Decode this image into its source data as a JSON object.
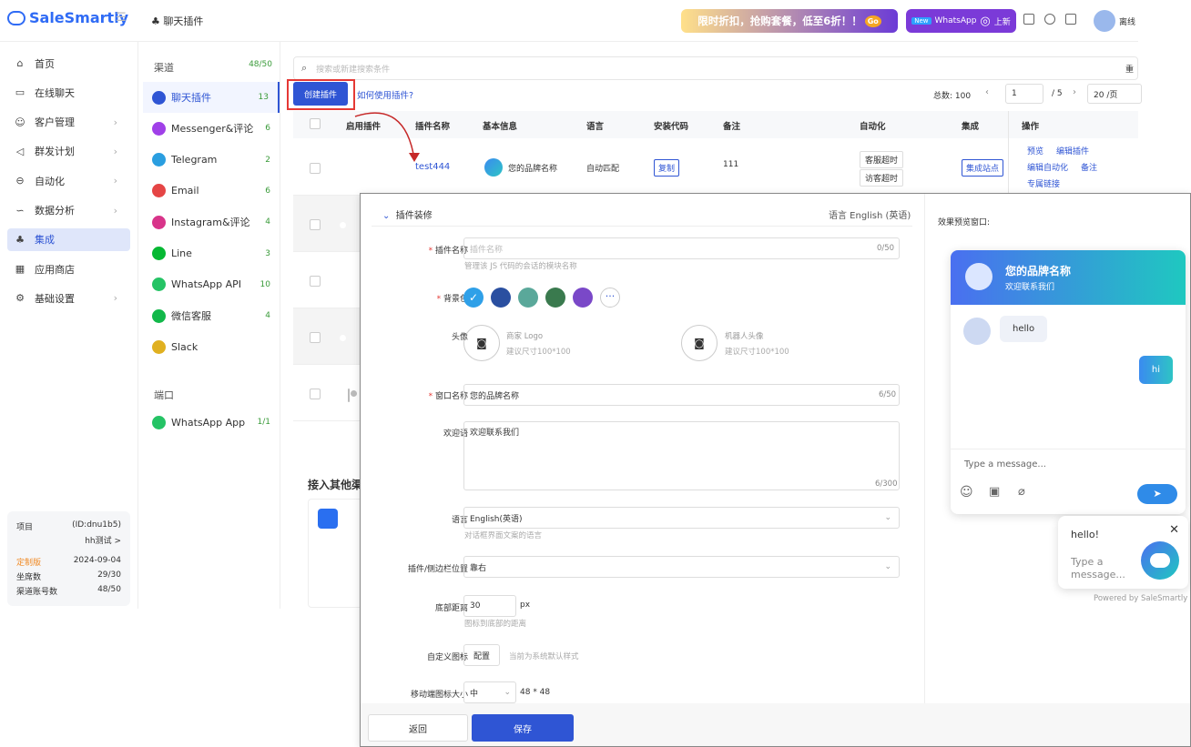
{
  "app": {
    "name": "SaleSmartly",
    "breadcrumb": "聊天插件"
  },
  "header": {
    "promo_text": "限时折扣，抢购套餐，低至6折！！",
    "promo_badge": "Go",
    "wa_new_tag": "New",
    "wa_new_text": "WhatsApp",
    "wa_new_suffix": "上新",
    "status": "离线"
  },
  "nav": {
    "items": [
      {
        "label": "首页",
        "icon": "home-icon",
        "glyph": "⌂"
      },
      {
        "label": "在线聊天",
        "icon": "chat-icon",
        "glyph": "▭"
      },
      {
        "label": "客户管理",
        "icon": "users-icon",
        "glyph": "☺",
        "chev": true
      },
      {
        "label": "群发计划",
        "icon": "send-icon",
        "glyph": "◁",
        "chev": true
      },
      {
        "label": "自动化",
        "icon": "robot-icon",
        "glyph": "⊖",
        "chev": true
      },
      {
        "label": "数据分析",
        "icon": "chart-icon",
        "glyph": "∽",
        "chev": true
      },
      {
        "label": "集成",
        "icon": "integration-icon",
        "glyph": "♣",
        "active": true
      },
      {
        "label": "应用商店",
        "icon": "apps-icon",
        "glyph": "▦"
      },
      {
        "label": "基础设置",
        "icon": "settings-icon",
        "glyph": "⚙",
        "chev": true
      }
    ]
  },
  "project": {
    "label": "项目",
    "id": "(ID:dnu1b5)",
    "name": "hh测试 >",
    "plan": "定制版",
    "plan_date": "2024-09-04",
    "seats_label": "坐席数",
    "seats": "29/30",
    "channels_label": "渠道账号数",
    "channels": "48/50"
  },
  "channels": {
    "header": "渠道",
    "header_count": "48/50",
    "items": [
      {
        "label": "聊天插件",
        "count": "13",
        "color": "#2f55d4",
        "active": true
      },
      {
        "label": "Messenger&评论",
        "count": "6",
        "color": "#a040e8"
      },
      {
        "label": "Telegram",
        "count": "2",
        "color": "#2a9ee0"
      },
      {
        "label": "Email",
        "count": "6",
        "color": "#e54545"
      },
      {
        "label": "Instagram&评论",
        "count": "4",
        "color": "#d8348a"
      },
      {
        "label": "Line",
        "count": "3",
        "color": "#06b833"
      },
      {
        "label": "WhatsApp API",
        "count": "10",
        "color": "#25c365"
      },
      {
        "label": "微信客服",
        "count": "4",
        "color": "#12b84a"
      },
      {
        "label": "Slack",
        "count": "",
        "color": "#e0b020"
      }
    ],
    "section2": "端口",
    "app_items": [
      {
        "label": "WhatsApp App",
        "count": "1/1",
        "color": "#25c365"
      }
    ]
  },
  "toolbar": {
    "search_placeholder": "搜索或新建搜索条件",
    "reset": "重",
    "create": "创建插件",
    "howto": "如何使用插件?",
    "total": "总数: 100",
    "page": "1",
    "pages": "/ 5",
    "page_size": "20 /页"
  },
  "table": {
    "headers": [
      "启用插件",
      "插件名称",
      "基本信息",
      "语言",
      "安装代码",
      "备注",
      "自动化",
      "集成",
      "操作"
    ],
    "row1": {
      "name": "test444",
      "brand": "您的品牌名称",
      "lang": "自动匹配",
      "code": "复制",
      "note": "111",
      "auto1": "客服超时",
      "auto2": "访客超时",
      "integ": "集成站点",
      "ops": [
        "预览",
        "编辑插件",
        "编辑自动化",
        "备注",
        "专属链接"
      ]
    }
  },
  "other_title": "接入其他渠",
  "form": {
    "section": "插件装修",
    "language_switch": "语言 English (英语)",
    "name_label": "插件名称",
    "name_placeholder": "插件名称",
    "name_count": "0/50",
    "name_hint": "管理该 JS 代码的会话的模块名称",
    "bg_label": "背景色",
    "avatar_label": "头像",
    "merchant_logo": "商家 Logo",
    "merchant_hint": "建议尺寸100*100",
    "robot_avatar": "机器人头像",
    "robot_hint": "建议尺寸100*100",
    "window_label": "窗口名称",
    "window_value": "您的品牌名称",
    "window_count": "6/50",
    "welcome_label": "欢迎语",
    "welcome_value": "欢迎联系我们",
    "welcome_count": "6/300",
    "lang_label": "语言",
    "lang_value": "English(英语)",
    "lang_hint": "对话框界面文案的语言",
    "pos_label": "插件/侧边栏位置",
    "pos_value": "靠右",
    "bottom_label": "底部距离",
    "bottom_value": "30",
    "bottom_unit": "px",
    "bottom_hint": "图标到底部的距离",
    "icon_label": "自定义图标",
    "icon_btn": "配置",
    "icon_hint": "当前为系统默认样式",
    "mobile_label": "移动端图标大小",
    "mobile_value": "中",
    "mobile_size": "48 * 48",
    "back": "返回",
    "save": "保存"
  },
  "preview": {
    "title": "效果预览窗口:",
    "brand": "您的品牌名称",
    "welcome": "欢迎联系我们",
    "msg_in": "hello",
    "msg_out": "hi",
    "input_placeholder": "Type a message...",
    "popup_msg": "hello!",
    "popup_placeholder": "Type a message...",
    "powered": "Powered by SaleSmartly"
  },
  "colors": {
    "primary": "#2f55d4",
    "swatches": [
      "#2fa0e8",
      "#2a4fa0",
      "#5aa89a",
      "#3a7a4e",
      "#7a48c8"
    ]
  }
}
